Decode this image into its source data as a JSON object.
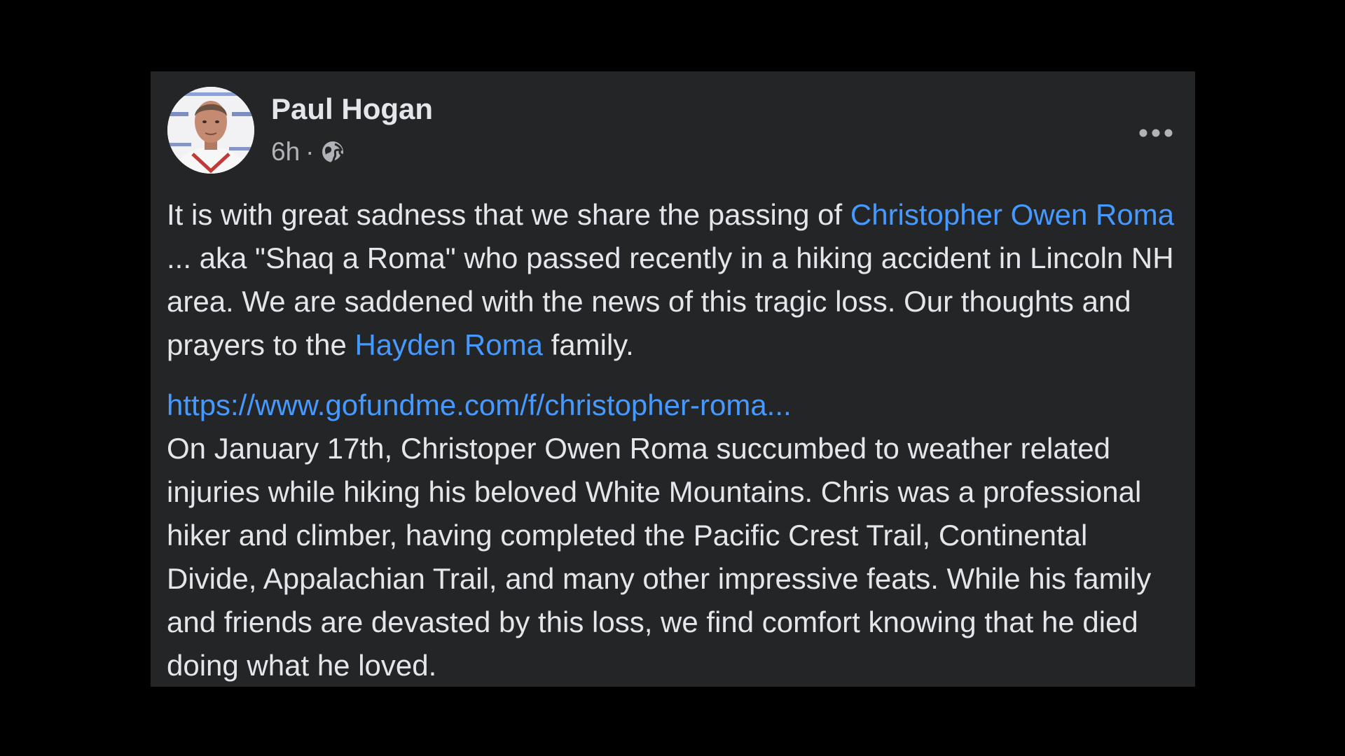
{
  "post": {
    "author": "Paul Hogan",
    "time": "6h",
    "separator": "·",
    "audience_icon": "globe-icon",
    "more_icon": "more-options-icon",
    "paragraph1": {
      "text1": "It is with great sadness that we share the passing of ",
      "mention1": "Christopher Owen Roma",
      "text2": " ... aka \"Shaq a Roma\" who passed recently in a hiking accident in Lincoln NH area. We are saddened with the news of this tragic loss. Our thoughts and prayers to the ",
      "mention2": "Hayden Roma",
      "text3": " family."
    },
    "link": "https://www.gofundme.com/f/christopher-roma...",
    "paragraph2": "On January 17th, Christoper Owen Roma succumbed to weather related injuries while hiking his beloved White Mountains. Chris was a professional hiker and climber, having completed the Pacific Crest Trail, Continental Divide, Appalachian Trail, and many other impressive feats. While his family and friends are devasted by this loss, we find comfort knowing that he died doing what he loved."
  },
  "colors": {
    "background": "#000000",
    "card": "#242526",
    "text": "#e4e6eb",
    "secondary_text": "#b0b3b8",
    "link": "#4599ff"
  }
}
